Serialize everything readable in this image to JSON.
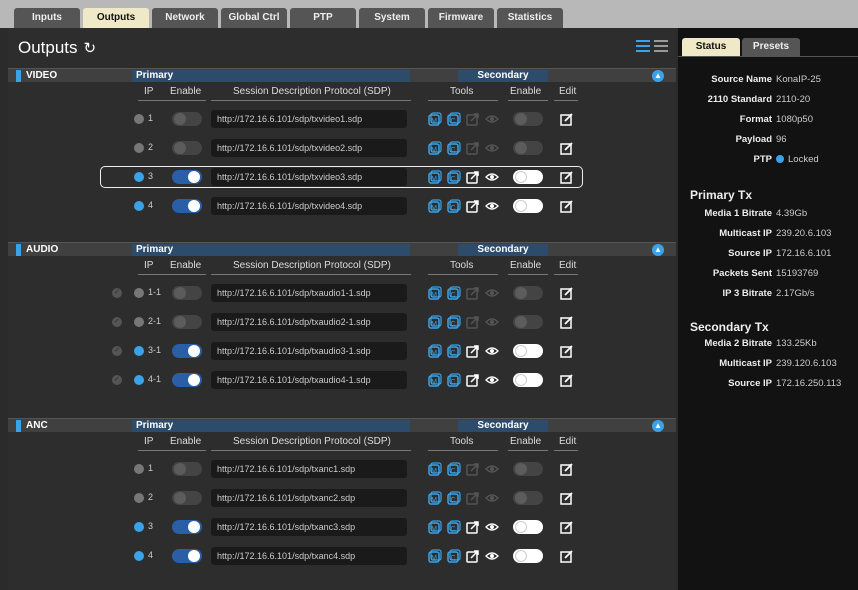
{
  "tabs": [
    "Inputs",
    "Outputs",
    "Network",
    "Global Ctrl",
    "PTP",
    "System",
    "Firmware",
    "Statistics"
  ],
  "active_tab": "Outputs",
  "page_title": "Outputs",
  "columns": {
    "ip": "IP",
    "enable": "Enable",
    "sdp": "Session Description Protocol (SDP)",
    "tools": "Tools",
    "enable2": "Enable",
    "edit": "Edit"
  },
  "sections": [
    {
      "name": "VIDEO",
      "primary": "Primary",
      "secondary": "Secondary",
      "rows": [
        {
          "ip": "1",
          "enabled": false,
          "sdp": "http://172.16.6.101/sdp/txvideo1.sdp",
          "secondary_enabled": false
        },
        {
          "ip": "2",
          "enabled": false,
          "sdp": "http://172.16.6.101/sdp/txvideo2.sdp",
          "secondary_enabled": false
        },
        {
          "ip": "3",
          "enabled": true,
          "sdp": "http://172.16.6.101/sdp/txvideo3.sdp",
          "secondary_enabled": true
        },
        {
          "ip": "4",
          "enabled": true,
          "sdp": "http://172.16.6.101/sdp/txvideo4.sdp",
          "secondary_enabled": true
        }
      ]
    },
    {
      "name": "AUDIO",
      "primary": "Primary",
      "secondary": "Secondary",
      "rows": [
        {
          "ip": "1-1",
          "enabled": false,
          "sdp": "http://172.16.6.101/sdp/txaudio1-1.sdp",
          "secondary_enabled": false
        },
        {
          "ip": "2-1",
          "enabled": false,
          "sdp": "http://172.16.6.101/sdp/txaudio2-1.sdp",
          "secondary_enabled": false
        },
        {
          "ip": "3-1",
          "enabled": true,
          "sdp": "http://172.16.6.101/sdp/txaudio3-1.sdp",
          "secondary_enabled": true
        },
        {
          "ip": "4-1",
          "enabled": true,
          "sdp": "http://172.16.6.101/sdp/txaudio4-1.sdp",
          "secondary_enabled": true
        }
      ]
    },
    {
      "name": "ANC",
      "primary": "Primary",
      "secondary": "Secondary",
      "rows": [
        {
          "ip": "1",
          "enabled": false,
          "sdp": "http://172.16.6.101/sdp/txanc1.sdp",
          "secondary_enabled": false
        },
        {
          "ip": "2",
          "enabled": false,
          "sdp": "http://172.16.6.101/sdp/txanc2.sdp",
          "secondary_enabled": false
        },
        {
          "ip": "3",
          "enabled": true,
          "sdp": "http://172.16.6.101/sdp/txanc3.sdp",
          "secondary_enabled": true
        },
        {
          "ip": "4",
          "enabled": true,
          "sdp": "http://172.16.6.101/sdp/txanc4.sdp",
          "secondary_enabled": true
        }
      ]
    }
  ],
  "status_panel": {
    "tabs": [
      "Status",
      "Presets"
    ],
    "general": [
      {
        "k": "Source Name",
        "v": "KonaIP-25"
      },
      {
        "k": "2110 Standard",
        "v": "2110-20"
      },
      {
        "k": "Format",
        "v": "1080p50"
      },
      {
        "k": "Payload",
        "v": "96"
      },
      {
        "k": "PTP",
        "v": "Locked"
      }
    ],
    "primary_tx_title": "Primary Tx",
    "primary_tx": [
      {
        "k": "Media 1 Bitrate",
        "v": "4.39Gb"
      },
      {
        "k": "Multicast IP",
        "v": "239.20.6.103"
      },
      {
        "k": "Source IP",
        "v": "172.16.6.101"
      },
      {
        "k": "Packets Sent",
        "v": "15193769"
      },
      {
        "k": "IP 3 Bitrate",
        "v": "2.17Gb/s"
      }
    ],
    "secondary_tx_title": "Secondary Tx",
    "secondary_tx": [
      {
        "k": "Media 2 Bitrate",
        "v": "133.25Kb"
      },
      {
        "k": "Multicast IP",
        "v": "239.120.6.103"
      },
      {
        "k": "Source IP",
        "v": "172.16.250.113"
      }
    ]
  },
  "colors": {
    "accent": "#3aa3e8",
    "active_tab": "#f0e9c8"
  }
}
